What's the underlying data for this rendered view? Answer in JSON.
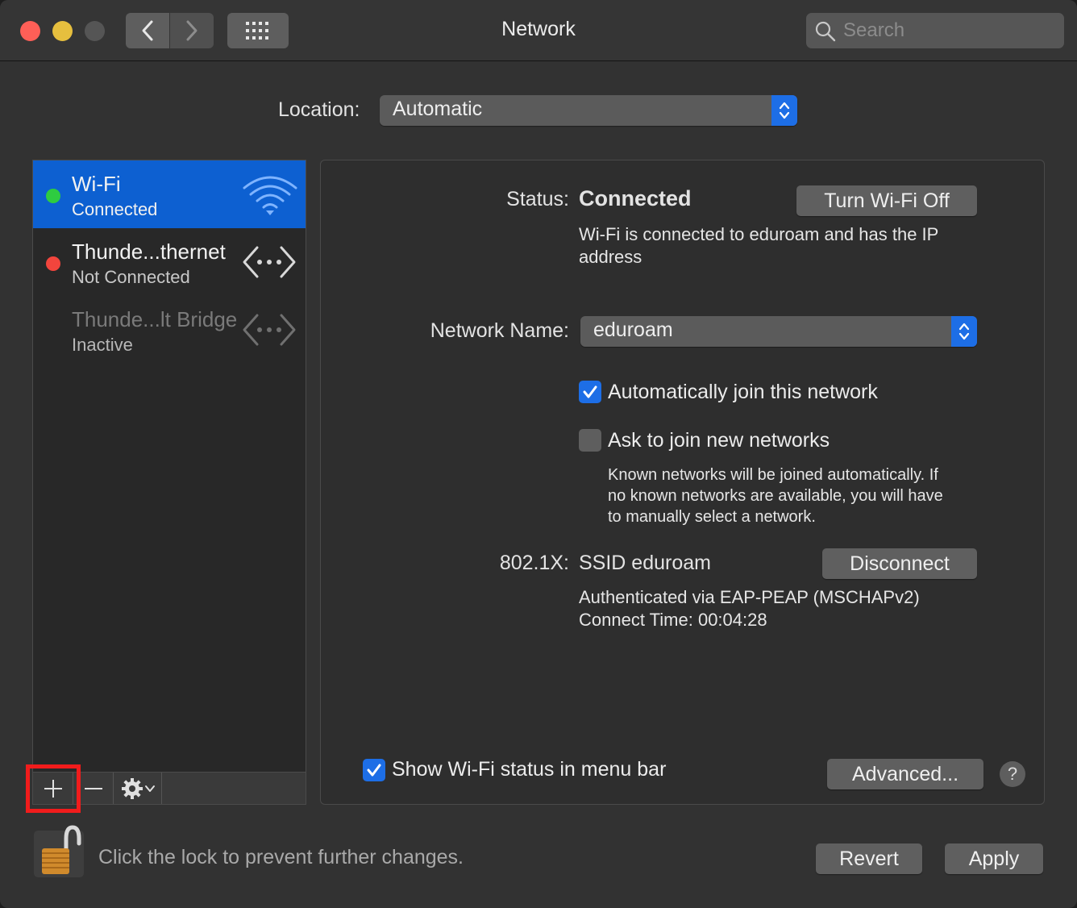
{
  "window": {
    "title": "Network",
    "search_placeholder": "Search"
  },
  "location": {
    "label": "Location:",
    "value": "Automatic"
  },
  "services": [
    {
      "name": "Wi-Fi",
      "status": "Connected",
      "status_color": "#2ecc40",
      "icon": "wifi-icon",
      "selected": true
    },
    {
      "name": "Thunde...thernet",
      "status": "Not Connected",
      "status_color": "#f2453d",
      "icon": "ethernet-arrows-icon",
      "selected": false
    },
    {
      "name": "Thunde...lt Bridge",
      "status": "Inactive",
      "status_color": "",
      "icon": "ethernet-arrows-icon",
      "selected": false
    }
  ],
  "detail": {
    "status_label": "Status:",
    "status_value": "Connected",
    "turn_off_button": "Turn Wi-Fi Off",
    "status_desc_line1": "Wi-Fi is connected to eduroam and has the IP",
    "status_desc_line2": "address",
    "network_name_label": "Network Name:",
    "network_name_value": "eduroam",
    "auto_join_label": "Automatically join this network",
    "auto_join_checked": true,
    "ask_join_label": "Ask to join new networks",
    "ask_join_checked": false,
    "ask_join_desc_line1": "Known networks will be joined automatically. If",
    "ask_join_desc_line2": "no known networks are available, you will have",
    "ask_join_desc_line3": "to manually select a network.",
    "dot1x_label": "802.1X:",
    "dot1x_value": "SSID eduroam",
    "disconnect_button": "Disconnect",
    "auth_line": "Authenticated via EAP-PEAP (MSCHAPv2)",
    "connect_time_line": "Connect Time: 00:04:28",
    "show_status_label": "Show Wi-Fi status in menu bar",
    "show_status_checked": true,
    "advanced_button": "Advanced...",
    "help_button": "?"
  },
  "footer": {
    "lock_text": "Click the lock to prevent further changes.",
    "revert_button": "Revert",
    "apply_button": "Apply"
  },
  "colors": {
    "accent": "#1d6ee6",
    "selection": "#0d60d1",
    "highlight_box": "#f11c1c"
  }
}
